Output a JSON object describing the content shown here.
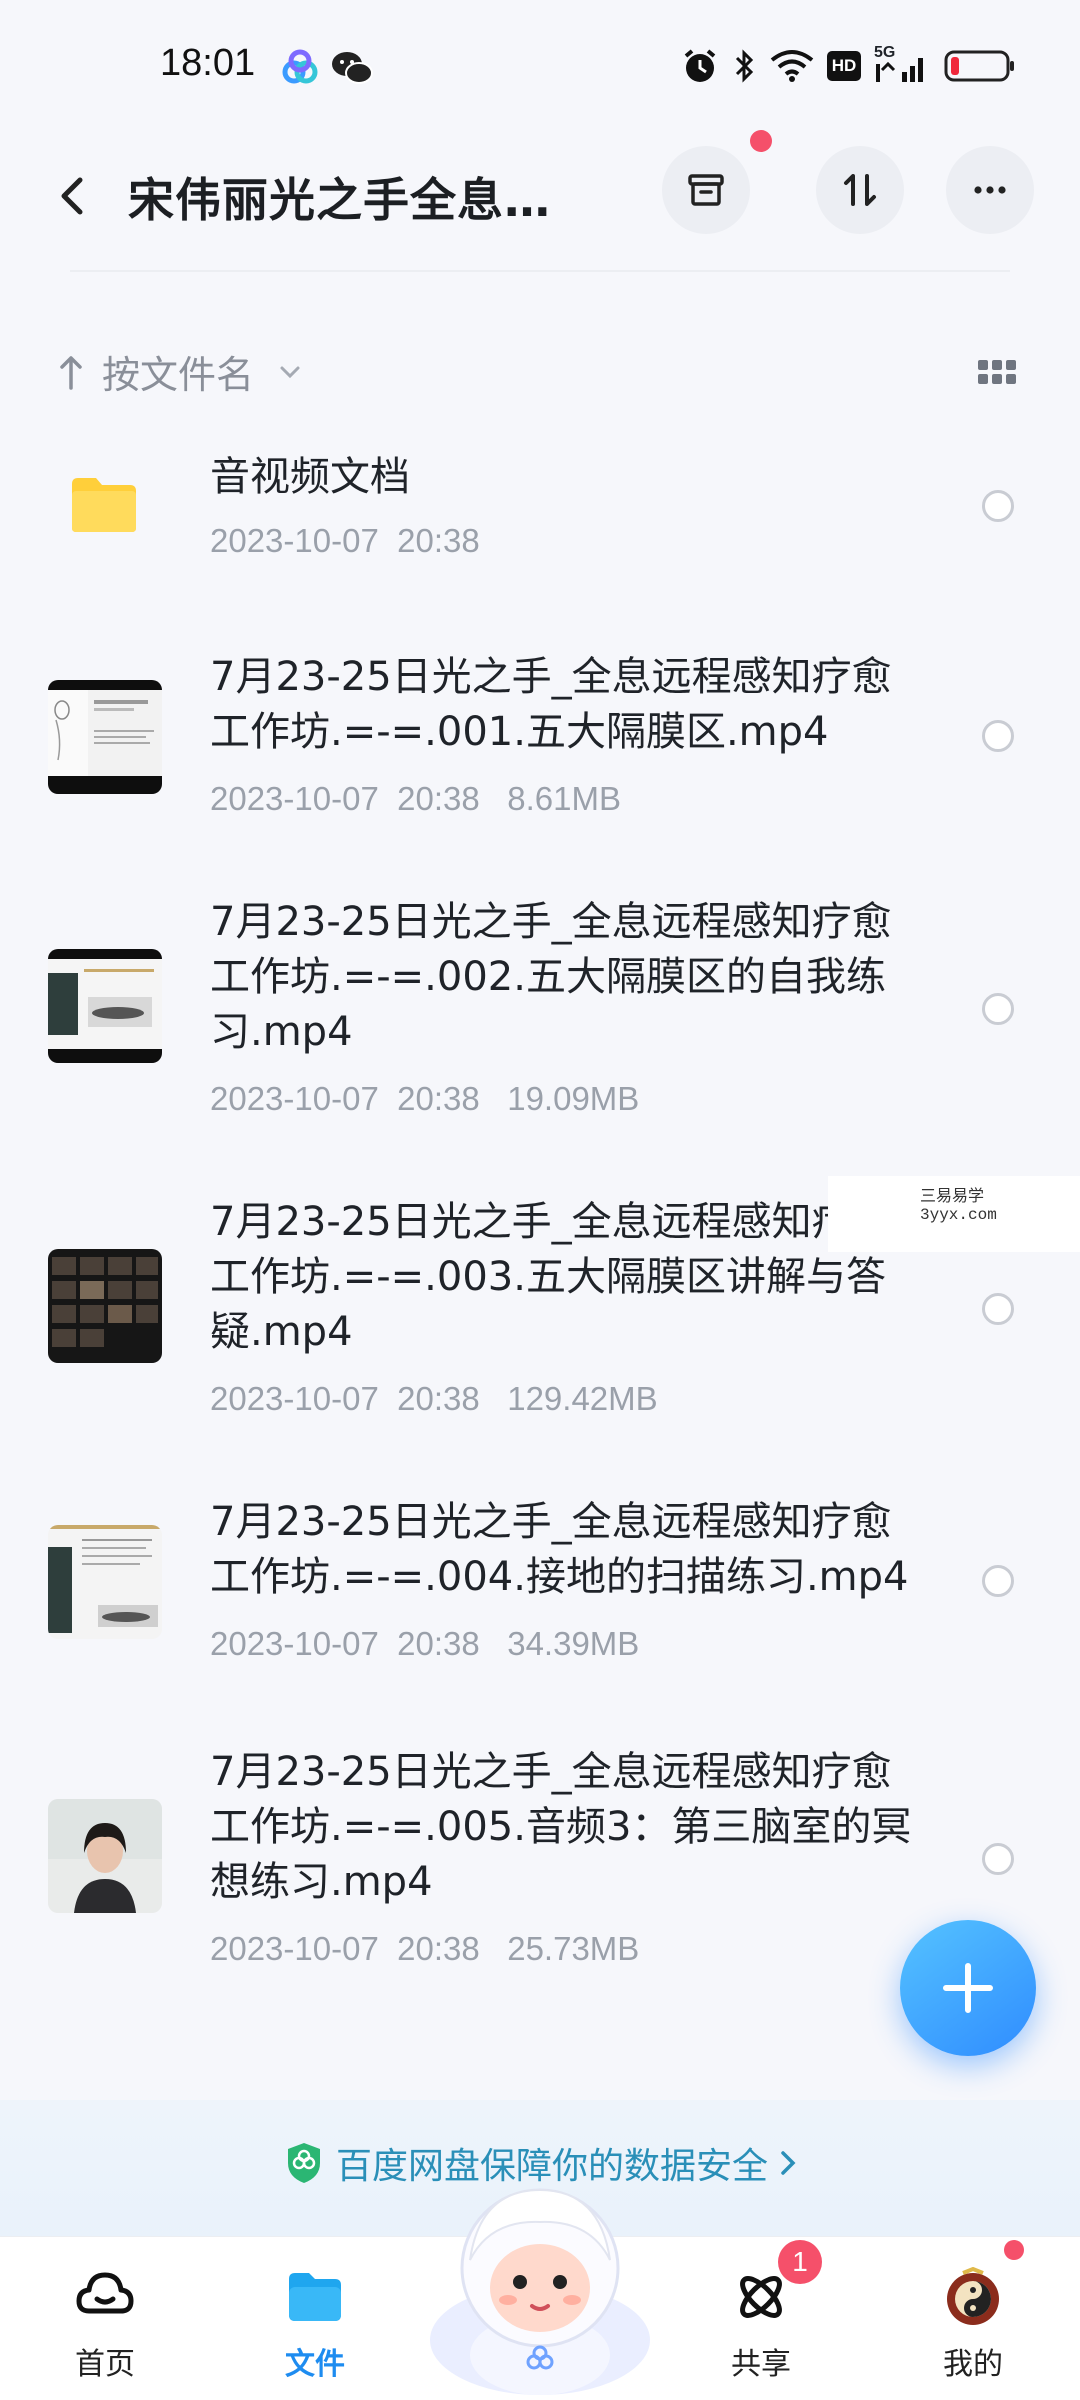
{
  "status_bar": {
    "time": "18:01",
    "icons": [
      "baidu-netdisk-icon",
      "wechat-icon",
      "alarm-icon",
      "bluetooth-icon",
      "wifi-icon",
      "hd-icon",
      "5g-signal-icon",
      "battery-low-icon"
    ],
    "hd_label": "HD",
    "net_label": "5G"
  },
  "header": {
    "title": "宋伟丽光之手全息…"
  },
  "sort": {
    "label": "按文件名"
  },
  "files": [
    {
      "name": "音视频文档",
      "meta": "2023-10-07  20:38",
      "kind": "folder"
    },
    {
      "name": "7月23-25日光之手_全息远程感知疗愈工作坊.=-=.001.五大隔膜区.mp4",
      "meta": "2023-10-07  20:38   8.61MB",
      "kind": "video"
    },
    {
      "name": "7月23-25日光之手_全息远程感知疗愈工作坊.=-=.002.五大隔膜区的自我练习.mp4",
      "meta": "2023-10-07  20:38   19.09MB",
      "kind": "video"
    },
    {
      "name": "7月23-25日光之手_全息远程感知疗愈工作坊.=-=.003.五大隔膜区讲解与答疑.mp4",
      "meta": "2023-10-07  20:38   129.42MB",
      "kind": "video"
    },
    {
      "name": "7月23-25日光之手_全息远程感知疗愈工作坊.=-=.004.接地的扫描练习.mp4",
      "meta": "2023-10-07  20:38   34.39MB",
      "kind": "video"
    },
    {
      "name": "7月23-25日光之手_全息远程感知疗愈工作坊.=-=.005.音频3：第三脑室的冥想练习.mp4",
      "meta": "2023-10-07  20:38   25.73MB",
      "kind": "video"
    }
  ],
  "watermark": {
    "line1": "三易易学",
    "line2": "3yyx.com"
  },
  "banner": {
    "text": "百度网盘保障你的数据安全"
  },
  "tabs": [
    {
      "label": "首页"
    },
    {
      "label": "文件"
    },
    {
      "label": "共享"
    },
    {
      "label": "我的"
    }
  ],
  "share_badge": "1",
  "colors": {
    "accent": "#1e8cf0",
    "badge": "#f5506a",
    "folder": "#ffd54a"
  }
}
